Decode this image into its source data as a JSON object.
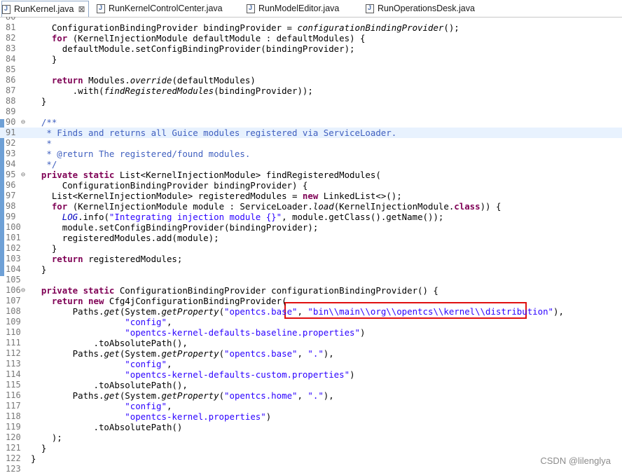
{
  "tabs": [
    {
      "label": "RunKernel.java",
      "active": true,
      "close": "⊠"
    },
    {
      "label": "RunKernelControlCenter.java",
      "active": false
    },
    {
      "label": "RunModelEditor.java",
      "active": false
    },
    {
      "label": "RunOperationsDesk.java",
      "active": false
    }
  ],
  "editor": {
    "lines": [
      {
        "n": "80",
        "fold": "",
        "html": ""
      },
      {
        "n": "81",
        "fold": "",
        "html": "    ConfigurationBindingProvider <span class=\"fld2\">bindingProvider</span> = <span class=\"it\">configurationBindingProvider</span>();"
      },
      {
        "n": "82",
        "fold": "",
        "html": "    <span class=\"kw\">for</span> (KernelInjectionModule defaultModule : defaultModules) {"
      },
      {
        "n": "83",
        "fold": "",
        "html": "      defaultModule.setConfigBindingProvider(bindingProvider);"
      },
      {
        "n": "84",
        "fold": "",
        "html": "    }"
      },
      {
        "n": "85",
        "fold": "",
        "html": ""
      },
      {
        "n": "86",
        "fold": "",
        "html": "    <span class=\"kw\">return</span> Modules.<span class=\"it\">override</span>(defaultModules)"
      },
      {
        "n": "87",
        "fold": "",
        "html": "        .with(<span class=\"it\">findRegisteredModules</span>(bindingProvider));"
      },
      {
        "n": "88",
        "fold": "",
        "html": "  }"
      },
      {
        "n": "89",
        "fold": "",
        "html": ""
      },
      {
        "n": "90",
        "fold": "⊖",
        "html": "  <span class=\"cmt\">/**</span>"
      },
      {
        "n": "91",
        "fold": "",
        "html": "<span class=\"cmt\">   * Finds and returns all Guice modules registered via ServiceLoader.</span>",
        "current": true
      },
      {
        "n": "92",
        "fold": "",
        "html": "<span class=\"cmt\">   *</span>"
      },
      {
        "n": "93",
        "fold": "",
        "html": "<span class=\"cmt\">   * @return The registered/found modules.</span>"
      },
      {
        "n": "94",
        "fold": "",
        "html": "<span class=\"cmt\">   */</span>"
      },
      {
        "n": "95",
        "fold": "⊖",
        "html": "  <span class=\"kw\">private static</span> List&lt;KernelInjectionModule&gt; findRegisteredModules("
      },
      {
        "n": "96",
        "fold": "",
        "html": "      ConfigurationBindingProvider bindingProvider) {"
      },
      {
        "n": "97",
        "fold": "",
        "html": "    List&lt;KernelInjectionModule&gt; registeredModules = <span class=\"kw\">new</span> LinkedList&lt;&gt;();"
      },
      {
        "n": "98",
        "fold": "",
        "html": "    <span class=\"kw\">for</span> (KernelInjectionModule module : ServiceLoader.<span class=\"it\">load</span>(KernelInjectionModule.<span class=\"kw\">class</span>)) {"
      },
      {
        "n": "99",
        "fold": "",
        "html": "      <span class=\"fld it\">LOG</span>.info(<span class=\"str\">\"Integrating injection module {}\"</span>, module.getClass().getName());"
      },
      {
        "n": "100",
        "fold": "",
        "html": "      module.setConfigBindingProvider(bindingProvider);"
      },
      {
        "n": "101",
        "fold": "",
        "html": "      registeredModules.add(module);"
      },
      {
        "n": "102",
        "fold": "",
        "html": "    }"
      },
      {
        "n": "103",
        "fold": "",
        "html": "    <span class=\"kw\">return</span> registeredModules;"
      },
      {
        "n": "104",
        "fold": "",
        "html": "  }"
      },
      {
        "n": "105",
        "fold": "",
        "html": ""
      },
      {
        "n": "106",
        "fold": "⊖",
        "html": "  <span class=\"kw\">private static</span> ConfigurationBindingProvider configurationBindingProvider() {"
      },
      {
        "n": "107",
        "fold": "",
        "html": "    <span class=\"kw\">return new</span> Cfg4jConfigurationBindingProvider("
      },
      {
        "n": "108",
        "fold": "",
        "html": "        Paths.<span class=\"it\">get</span>(System.<span class=\"it\">getProperty</span>(<span class=\"str\">\"opentcs.base\"</span>, <span class=\"str\">\"bin\\\\main\\\\org\\\\opentcs\\\\kernel\\\\distribution\"</span>),"
      },
      {
        "n": "109",
        "fold": "",
        "html": "                  <span class=\"str\">\"config\"</span>,"
      },
      {
        "n": "110",
        "fold": "",
        "html": "                  <span class=\"str\">\"opentcs-kernel-defaults-baseline.properties\"</span>)"
      },
      {
        "n": "111",
        "fold": "",
        "html": "            .toAbsolutePath(),"
      },
      {
        "n": "112",
        "fold": "",
        "html": "        Paths.<span class=\"it\">get</span>(System.<span class=\"it\">getProperty</span>(<span class=\"str\">\"opentcs.base\"</span>, <span class=\"str\">\".\"</span>),"
      },
      {
        "n": "113",
        "fold": "",
        "html": "                  <span class=\"str\">\"config\"</span>,"
      },
      {
        "n": "114",
        "fold": "",
        "html": "                  <span class=\"str\">\"opentcs-kernel-defaults-custom.properties\"</span>)"
      },
      {
        "n": "115",
        "fold": "",
        "html": "            .toAbsolutePath(),"
      },
      {
        "n": "116",
        "fold": "",
        "html": "        Paths.<span class=\"it\">get</span>(System.<span class=\"it\">getProperty</span>(<span class=\"str\">\"opentcs.home\"</span>, <span class=\"str\">\".\"</span>),"
      },
      {
        "n": "117",
        "fold": "",
        "html": "                  <span class=\"str\">\"config\"</span>,"
      },
      {
        "n": "118",
        "fold": "",
        "html": "                  <span class=\"str\">\"opentcs-kernel.properties\"</span>)"
      },
      {
        "n": "119",
        "fold": "",
        "html": "            .toAbsolutePath()"
      },
      {
        "n": "120",
        "fold": "",
        "html": "    );"
      },
      {
        "n": "121",
        "fold": "",
        "html": "  }"
      },
      {
        "n": "122",
        "fold": "",
        "html": "}"
      },
      {
        "n": "123",
        "fold": "",
        "html": ""
      }
    ]
  },
  "watermark": "CSDN @lilenglya",
  "colors": {
    "keyword": "#7f0055",
    "string": "#2a00ff",
    "comment": "#3f5fbf",
    "highlight_box": "#e01010"
  }
}
